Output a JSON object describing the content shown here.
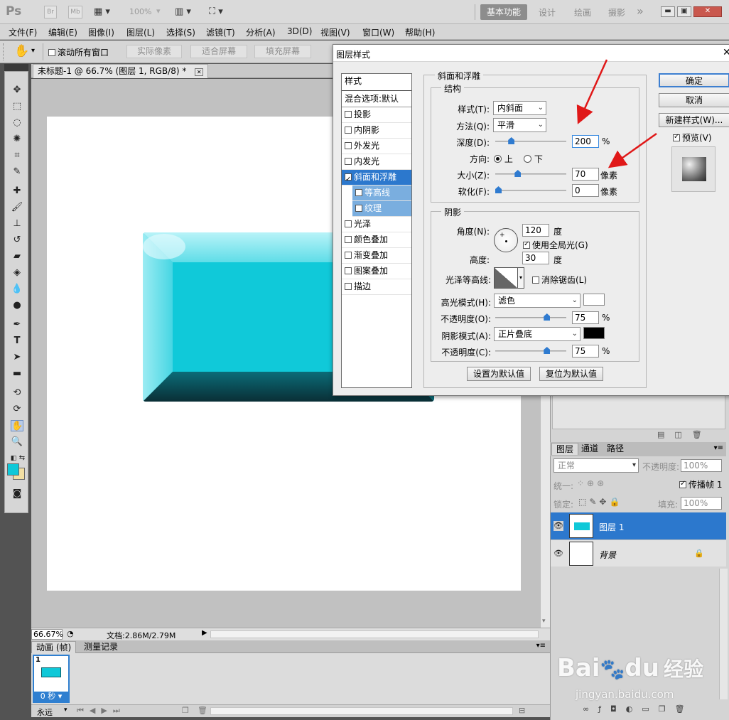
{
  "appbar": {
    "logo": "Ps",
    "buttons": [
      "Br",
      "Mb"
    ],
    "zoom": "100%",
    "workspace_active": "基本功能",
    "workspaces": [
      "设计",
      "绘画",
      "摄影"
    ],
    "more": "»"
  },
  "menu": [
    "文件(F)",
    "编辑(E)",
    "图像(I)",
    "图层(L)",
    "选择(S)",
    "滤镜(T)",
    "分析(A)",
    "3D(D)",
    "视图(V)",
    "窗口(W)",
    "帮助(H)"
  ],
  "options": {
    "scroll_all": "滚动所有窗口",
    "buttons": [
      "实际像素",
      "适合屏幕",
      "填充屏幕"
    ]
  },
  "document": {
    "tab_title": "未标题-1 @ 66.7% (图层 1, RGB/8) *",
    "zoom": "66.67%",
    "doc_info": "文档:2.86M/2.79M",
    "cyan_color": "#0fc8d8"
  },
  "animation": {
    "tabs": [
      "动画 (帧)",
      "测量记录"
    ],
    "frame_number": "1",
    "frame_time": "0 秒",
    "loop": "永远"
  },
  "layers": {
    "tabs": [
      "图层",
      "通道",
      "路径"
    ],
    "blend_mode": "正常",
    "opacity_label": "不透明度:",
    "opacity_value": "100%",
    "unify_label": "统一:",
    "propagate_label": "传播帧 1",
    "lock_label": "锁定:",
    "fill_label": "填充:",
    "fill_value": "100%",
    "items": [
      {
        "name": "图层 1",
        "selected": true
      },
      {
        "name": "背景",
        "selected": false
      }
    ]
  },
  "dialog": {
    "title": "图层样式",
    "styles_header": "样式",
    "blend_default": "混合选项:默认",
    "style_items": [
      {
        "label": "投影",
        "checked": false,
        "selected": false,
        "sub": false
      },
      {
        "label": "内阴影",
        "checked": false,
        "selected": false,
        "sub": false
      },
      {
        "label": "外发光",
        "checked": false,
        "selected": false,
        "sub": false
      },
      {
        "label": "内发光",
        "checked": false,
        "selected": false,
        "sub": false
      },
      {
        "label": "斜面和浮雕",
        "checked": true,
        "selected": true,
        "sub": false
      },
      {
        "label": "等高线",
        "checked": false,
        "selected": false,
        "sub": true
      },
      {
        "label": "纹理",
        "checked": false,
        "selected": false,
        "sub": true
      },
      {
        "label": "光泽",
        "checked": false,
        "selected": false,
        "sub": false
      },
      {
        "label": "颜色叠加",
        "checked": false,
        "selected": false,
        "sub": false
      },
      {
        "label": "渐变叠加",
        "checked": false,
        "selected": false,
        "sub": false
      },
      {
        "label": "图案叠加",
        "checked": false,
        "selected": false,
        "sub": false
      },
      {
        "label": "描边",
        "checked": false,
        "selected": false,
        "sub": false
      }
    ],
    "bevel_title": "斜面和浮雕",
    "structure": {
      "title": "结构",
      "style_label": "样式(T):",
      "style_value": "内斜面",
      "technique_label": "方法(Q):",
      "technique_value": "平滑",
      "depth_label": "深度(D):",
      "depth_value": "200",
      "depth_unit": "%",
      "depth_level": 0.2,
      "direction_label": "方向:",
      "direction_up": "上",
      "direction_down": "下",
      "size_label": "大小(Z):",
      "size_value": "70",
      "size_unit": "像素",
      "size_level": 0.3,
      "soften_label": "软化(F):",
      "soften_value": "0",
      "soften_unit": "像素",
      "soften_level": 0
    },
    "shading": {
      "title": "阴影",
      "angle_label": "角度(N):",
      "angle_value": "120",
      "angle_unit": "度",
      "global_light": "使用全局光(G)",
      "altitude_label": "高度:",
      "altitude_value": "30",
      "altitude_unit": "度",
      "gloss_label": "光泽等高线:",
      "anti_alias": "消除锯齿(L)",
      "highlight_label": "高光模式(H):",
      "highlight_value": "滤色",
      "highlight_color": "#ffffff",
      "hl_opacity_label": "不透明度(O):",
      "hl_opacity_value": "75",
      "hl_opacity_level": 0.75,
      "shadow_label": "阴影模式(A):",
      "shadow_value": "正片叠底",
      "shadow_color": "#000000",
      "sh_opacity_label": "不透明度(C):",
      "sh_opacity_value": "75",
      "sh_opacity_level": 0.75,
      "percent": "%"
    },
    "make_default": "设置为默认值",
    "reset_default": "复位为默认值",
    "ok": "确定",
    "cancel": "取消",
    "new_style": "新建样式(W)...",
    "preview": "预览(V)"
  },
  "watermark": {
    "brand": "Bai",
    "brand2": "du",
    "cn": "经验",
    "url": "jingyan.baidu.com"
  },
  "colors": {
    "selection_blue": "#2c78cd",
    "arrow_red": "#e01818"
  }
}
